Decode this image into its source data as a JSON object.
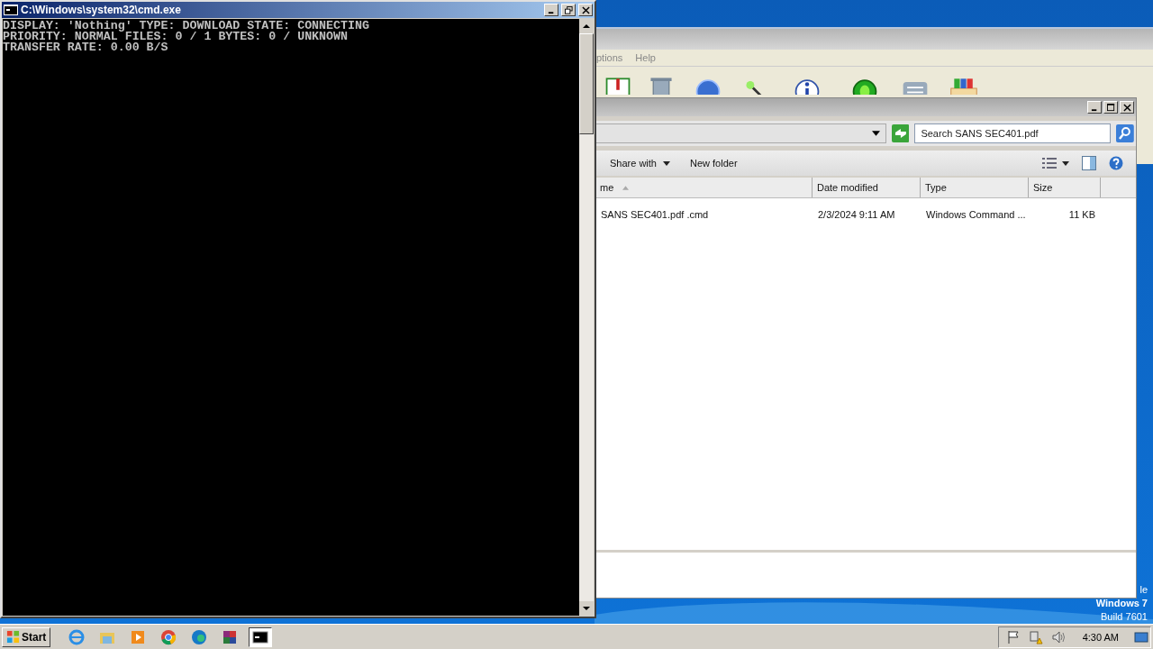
{
  "cmd_window": {
    "title": "C:\\Windows\\system32\\cmd.exe",
    "lines": [
      "DISPLAY: 'Nothing' TYPE: DOWNLOAD STATE: CONNECTING",
      "PRIORITY: NORMAL FILES: 0 / 1 BYTES: 0 / UNKNOWN",
      "TRANSFER RATE: 0.00 B/S"
    ]
  },
  "background_window": {
    "menu": [
      "ptions",
      "Help"
    ],
    "tools": [
      {
        "kind": "book"
      },
      {
        "kind": "trash"
      },
      {
        "kind": "disc"
      },
      {
        "kind": "wand"
      },
      {
        "kind": "info"
      },
      {
        "kind": "bug"
      },
      {
        "kind": "note"
      },
      {
        "kind": "box"
      }
    ]
  },
  "explorer": {
    "search": {
      "placeholder": "Search SANS SEC401.pdf"
    },
    "commands": [
      {
        "label": "Share with",
        "dropdown": true
      },
      {
        "label": "New folder",
        "dropdown": false
      }
    ],
    "columns": [
      {
        "label": "me",
        "sorted": true
      },
      {
        "label": "Date modified",
        "sorted": false
      },
      {
        "label": "Type",
        "sorted": false
      },
      {
        "label": "Size",
        "sorted": false
      }
    ],
    "rows": [
      {
        "cells": [
          "SANS SEC401.pdf .cmd",
          "2/3/2024 9:11 AM",
          "Windows Command ...",
          "11 KB"
        ],
        "selected": false
      }
    ]
  },
  "desktop": {
    "lines": [
      "le",
      "Windows 7",
      "Build 7601"
    ]
  },
  "taskbar": {
    "start": "Start",
    "items": [
      {
        "kind": "ie",
        "selected": false
      },
      {
        "kind": "folder",
        "selected": false
      },
      {
        "kind": "media",
        "selected": false
      },
      {
        "kind": "chrome",
        "selected": false
      },
      {
        "kind": "edge",
        "selected": false
      },
      {
        "kind": "winrar",
        "selected": false
      },
      {
        "kind": "console",
        "selected": true
      }
    ],
    "clock": "4:30 AM"
  }
}
